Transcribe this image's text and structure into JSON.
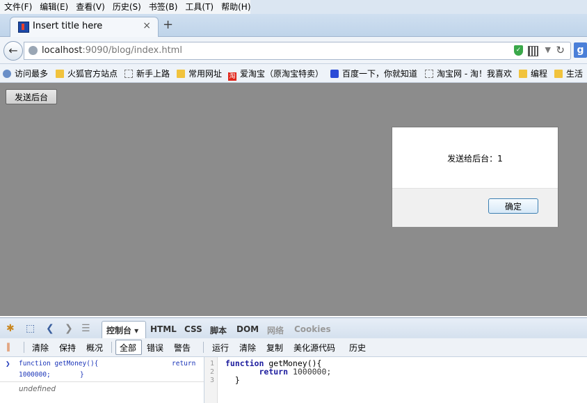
{
  "menu": [
    "文件(F)",
    "编辑(E)",
    "查看(V)",
    "历史(S)",
    "书签(B)",
    "工具(T)",
    "帮助(H)"
  ],
  "tab": {
    "title": "Insert title here",
    "close": "×",
    "new_tab": "+"
  },
  "address": {
    "host": "localhost",
    "rest": ":9090/blog/index.html"
  },
  "bookmarks": [
    "访问最多",
    "火狐官方站点",
    "新手上路",
    "常用网址",
    "爱淘宝（原淘宝特卖）",
    "百度一下，你就知道",
    "淘宝网 - 淘！我喜欢",
    "编程",
    "生活"
  ],
  "page": {
    "send_button": "发送后台"
  },
  "dialog": {
    "message": "发送给后台：1",
    "ok": "确定"
  },
  "devtools": {
    "tabs": [
      "控制台 ▾",
      "HTML",
      "CSS",
      "脚本",
      "DOM",
      "网络",
      "Cookies"
    ],
    "toolbar": [
      "清除",
      "保持",
      "概况",
      "全部",
      "错误",
      "警告",
      "运行",
      "清除",
      "复制",
      "美化源代码",
      "历史"
    ],
    "console": {
      "line1": "function getMoney(){",
      "line1_right": "return",
      "line2": "1000000;",
      "line2_brace": "}",
      "result": "undefined"
    },
    "editor": {
      "line_numbers": [
        "1",
        "2",
        "3"
      ],
      "kw_function": "function",
      "fn_sig": " getMoney(){",
      "indent": "       ",
      "kw_return": "return",
      "ret_val": " 1000000;",
      "close": "  }"
    }
  }
}
